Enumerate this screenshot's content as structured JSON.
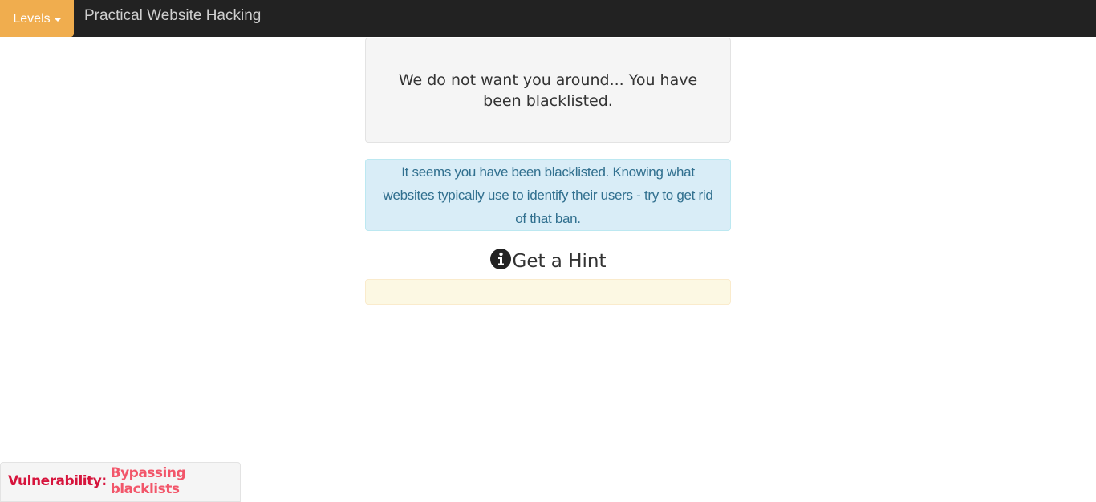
{
  "navbar": {
    "levels_label": "Levels",
    "brand": "Practical Website Hacking",
    "icons": {
      "levels_caret": "caret-down-icon"
    }
  },
  "main": {
    "blacklist_message": "We do not want you around... You have been blacklisted.",
    "info_alert": "It seems you have been blacklisted. Knowing what websites typically use to identify their users - try to get rid of that ban.",
    "hint": {
      "label": "Get a Hint",
      "icon": "info-circle-icon",
      "content": ""
    }
  },
  "footer": {
    "vulnerability_prefix": "Vulnerability:",
    "vulnerability_name": "Bypassing blacklists"
  },
  "colors": {
    "navbar_bg": "#222222",
    "levels_button": "#f0ad4e",
    "well_bg": "#f5f5f5",
    "info_bg": "#d9edf7",
    "info_text": "#31708f",
    "hint_bg": "#fcf8e3",
    "vuln_prefix": "#d6143c",
    "vuln_name": "#f2566a"
  }
}
